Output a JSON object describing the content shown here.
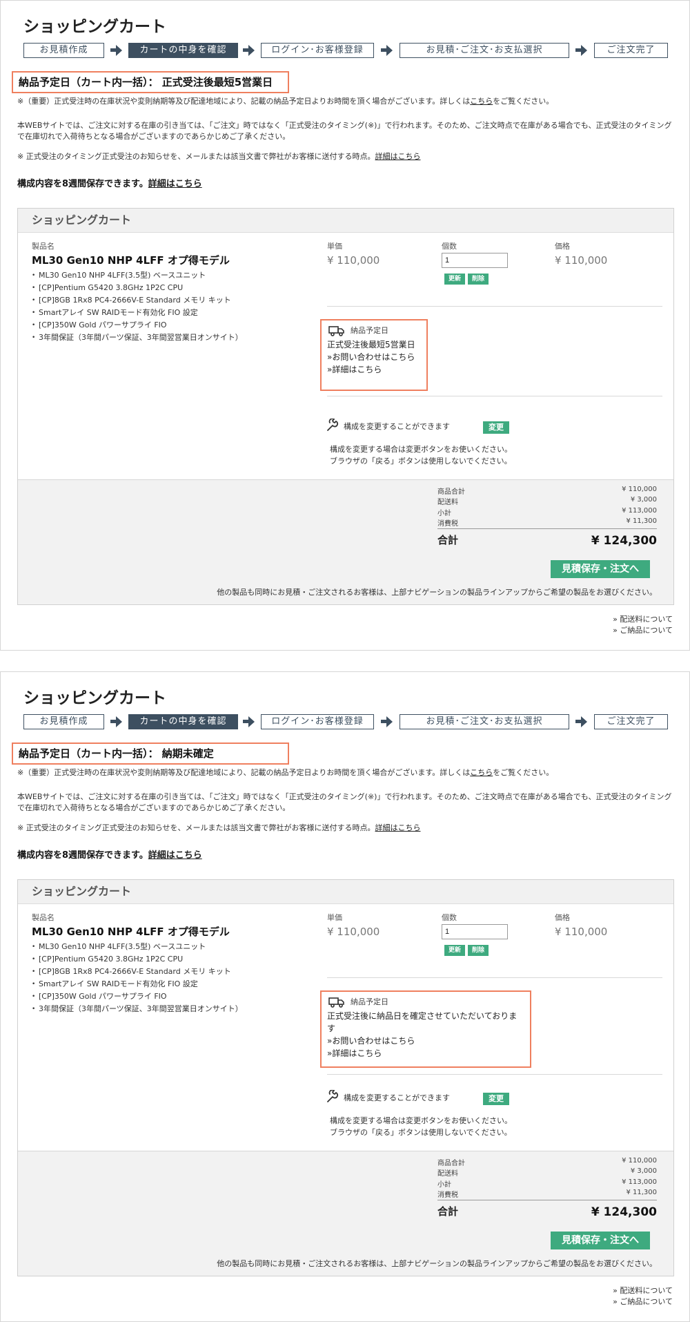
{
  "panels": [
    {
      "page_title": "ショッピングカート",
      "steps": [
        "お見積作成",
        "カートの中身を確認",
        "ログイン･お客様登録",
        "お見積･ご注文･お支払選択",
        "ご注文完了"
      ],
      "delivery_heading": "納品予定日（カート内一括）： 正式受注後最短5営業日",
      "notice1_pre": "※（重要）正式受注時の在庫状況や変則納期等及び配達地域により、記載の納品予定日よりお時間を頂く場合がございます。詳しくは",
      "notice1_link": "こちら",
      "notice1_post": "をご覧ください。",
      "notice2": "本WEBサイトでは、ご注文に対する在庫の引き当ては、「ご注文」時ではなく「正式受注のタイミング(※)」で行われます。そのため、ご注文時点で在庫がある場合でも、正式受注のタイミングで在庫切れで入荷待ちとなる場合がございますのであらかじめご了承ください。",
      "notice3_pre": "※ 正式受注のタイミング正式受注のお知らせを、メールまたは該当文書で弊社がお客様に送付する時点。",
      "notice3_link": "詳細はこちら",
      "save_note": "構成内容を8週間保存できます。",
      "save_link": "詳細はこちら",
      "cart": {
        "header": "ショッピングカート",
        "col_product": "製品名",
        "col_unit_price": "単価",
        "col_qty": "個数",
        "col_price": "価格",
        "product_name": "ML30 Gen10 NHP 4LFF オプ得モデル",
        "specs": [
          "ML30 Gen10 NHP 4LFF(3.5型) ベースユニット",
          "[CP]Pentium G5420 3.8GHz 1P2C CPU",
          "[CP]8GB 1Rx8 PC4-2666V-E Standard メモリ キット",
          "Smartアレイ SW RAIDモード有効化 FIO 設定",
          "[CP]350W Gold パワーサプライ FIO",
          "3年間保証（3年間パーツ保証、3年間翌営業日オンサイト）"
        ],
        "unit_price": "¥ 110,000",
        "qty_value": "1",
        "price": "¥ 110,000",
        "update_btn": "更新",
        "delete_btn": "削除",
        "delivery_title": "納品予定日",
        "delivery_lines": [
          "正式受注後最短5営業日"
        ],
        "inquiry_link": "»お問い合わせはこちら",
        "detail_link": "»詳細はこちら",
        "change_label": "構成を変更することができます",
        "change_btn": "変更",
        "change_note1": "構成を変更する場合は変更ボタンをお使いください。",
        "change_note2": "ブラウザの「戻る」ボタンは使用しないでください。",
        "summary": [
          {
            "label": "商品合計",
            "value": "¥ 110,000"
          },
          {
            "label": "配送料",
            "value": "¥ 3,000"
          },
          {
            "label": "小計",
            "value": "¥ 113,000"
          },
          {
            "label": "消費税",
            "value": "¥ 11,300"
          }
        ],
        "total_label": "合計",
        "total_value": "¥ 124,300",
        "order_btn": "見積保存・注文へ",
        "other_note": "他の製品も同時にお見積・ご注文されるお客様は、上部ナビゲーションの製品ラインアップからご希望の製品をお選びください。"
      },
      "footer_links": [
        "» 配送料について",
        "» ご納品について"
      ]
    },
    {
      "page_title": "ショッピングカート",
      "steps": [
        "お見積作成",
        "カートの中身を確認",
        "ログイン･お客様登録",
        "お見積･ご注文･お支払選択",
        "ご注文完了"
      ],
      "delivery_heading": "納品予定日（カート内一括）： 納期未確定",
      "notice1_pre": "※（重要）正式受注時の在庫状況や変則納期等及び配達地域により、記載の納品予定日よりお時間を頂く場合がございます。詳しくは",
      "notice1_link": "こちら",
      "notice1_post": "をご覧ください。",
      "notice2": "本WEBサイトでは、ご注文に対する在庫の引き当ては、「ご注文」時ではなく「正式受注のタイミング(※)」で行われます。そのため、ご注文時点で在庫がある場合でも、正式受注のタイミングで在庫切れで入荷待ちとなる場合がございますのであらかじめご了承ください。",
      "notice3_pre": "※ 正式受注のタイミング正式受注のお知らせを、メールまたは該当文書で弊社がお客様に送付する時点。",
      "notice3_link": "詳細はこちら",
      "save_note": "構成内容を8週間保存できます。",
      "save_link": "詳細はこちら",
      "cart": {
        "header": "ショッピングカート",
        "col_product": "製品名",
        "col_unit_price": "単価",
        "col_qty": "個数",
        "col_price": "価格",
        "product_name": "ML30 Gen10 NHP 4LFF オプ得モデル",
        "specs": [
          "ML30 Gen10 NHP 4LFF(3.5型) ベースユニット",
          "[CP]Pentium G5420 3.8GHz 1P2C CPU",
          "[CP]8GB 1Rx8 PC4-2666V-E Standard メモリ キット",
          "Smartアレイ SW RAIDモード有効化 FIO 設定",
          "[CP]350W Gold パワーサプライ FIO",
          "3年間保証（3年間パーツ保証、3年間翌営業日オンサイト）"
        ],
        "unit_price": "¥ 110,000",
        "qty_value": "1",
        "price": "¥ 110,000",
        "update_btn": "更新",
        "delete_btn": "削除",
        "delivery_title": "納品予定日",
        "delivery_lines": [
          "正式受注後に納品日を確定させていただいておりま",
          "す"
        ],
        "inquiry_link": "»お問い合わせはこちら",
        "detail_link": "»詳細はこちら",
        "change_label": "構成を変更することができます",
        "change_btn": "変更",
        "change_note1": "構成を変更する場合は変更ボタンをお使いください。",
        "change_note2": "ブラウザの「戻る」ボタンは使用しないでください。",
        "summary": [
          {
            "label": "商品合計",
            "value": "¥ 110,000"
          },
          {
            "label": "配送料",
            "value": "¥ 3,000"
          },
          {
            "label": "小計",
            "value": "¥ 113,000"
          },
          {
            "label": "消費税",
            "value": "¥ 11,300"
          }
        ],
        "total_label": "合計",
        "total_value": "¥ 124,300",
        "order_btn": "見積保存・注文へ",
        "other_note": "他の製品も同時にお見積・ご注文されるお客様は、上部ナビゲーションの製品ラインアップからご希望の製品をお選びください。"
      },
      "footer_links": [
        "» 配送料について",
        "» ご納品について"
      ]
    }
  ]
}
